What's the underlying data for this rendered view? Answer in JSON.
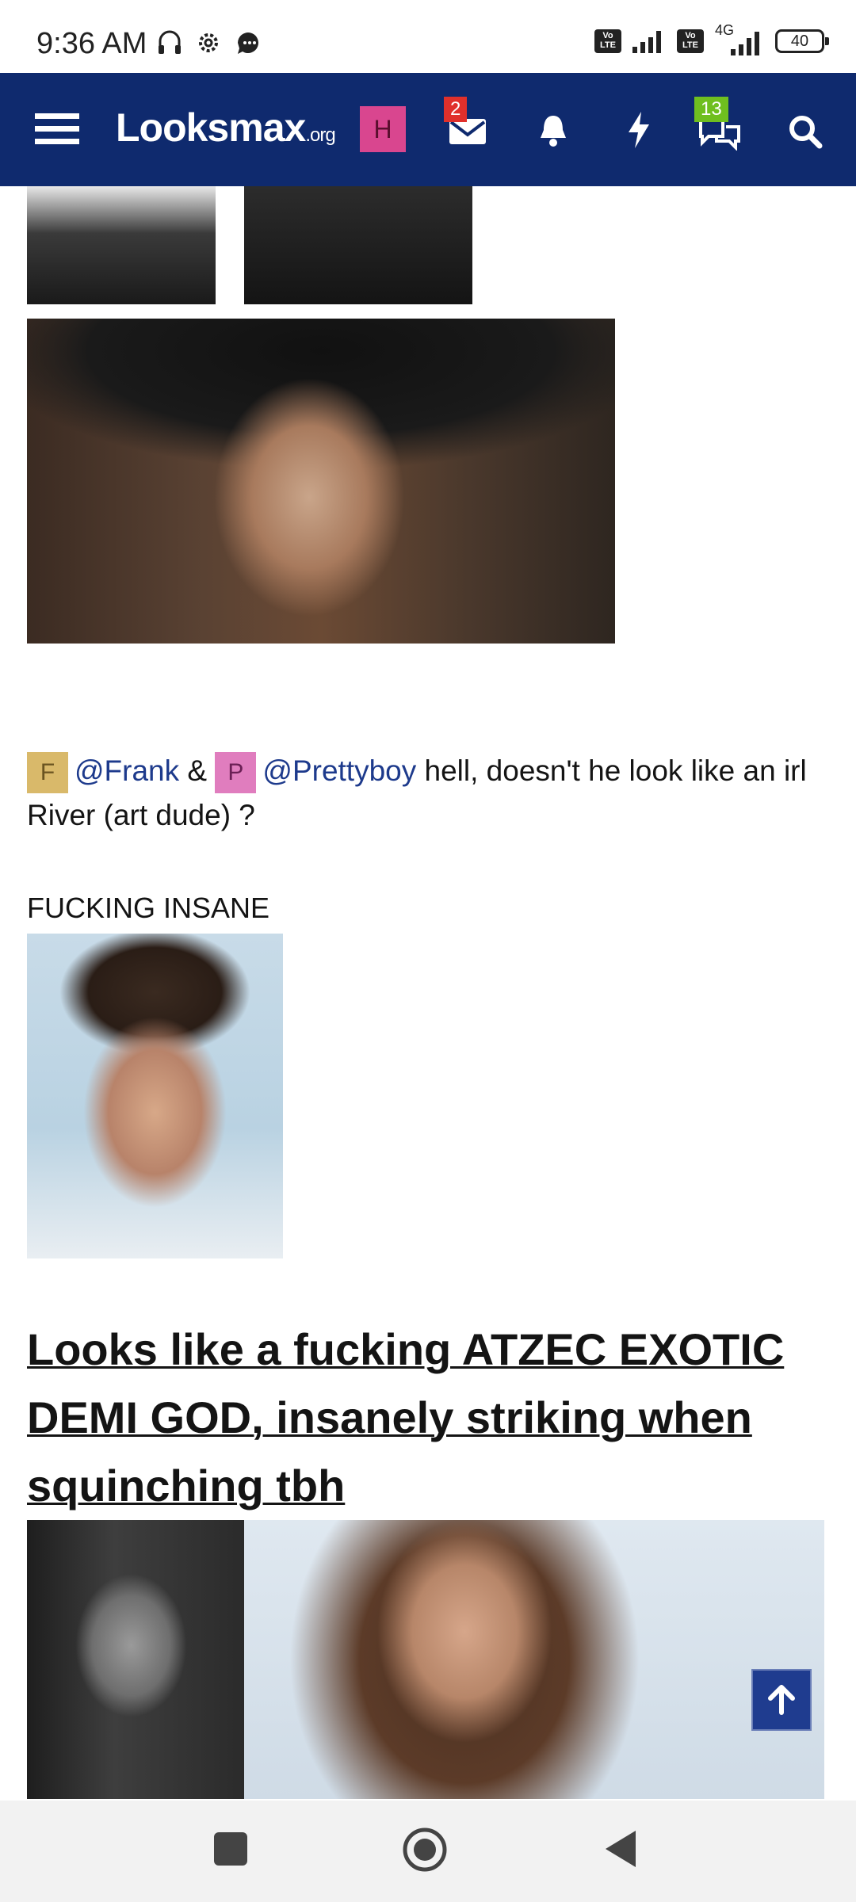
{
  "status_bar": {
    "time": "9:36 AM",
    "network": "4G",
    "battery": "40",
    "volte": "Vo LTE"
  },
  "navbar": {
    "logo_main": "Looksmax",
    "logo_suffix": ".org",
    "avatar_letter": "H",
    "messages_badge": "2",
    "conversations_badge": "13",
    "colors": {
      "bar": "#0f2a6e",
      "avatar": "#d9468f"
    }
  },
  "post": {
    "mention_line": {
      "frank_avatar": "F",
      "frank": "@Frank",
      "amp": "&",
      "prettyboy_avatar": "P",
      "prettyboy": "@Prettyboy",
      "text": "hell, doesn't he look like an irl River (art dude) ?"
    },
    "caption": "FUCKING INSANE",
    "headline": "Looks like a fucking ATZEC EXOTIC DEMI GOD, insanely striking when squinching tbh"
  }
}
